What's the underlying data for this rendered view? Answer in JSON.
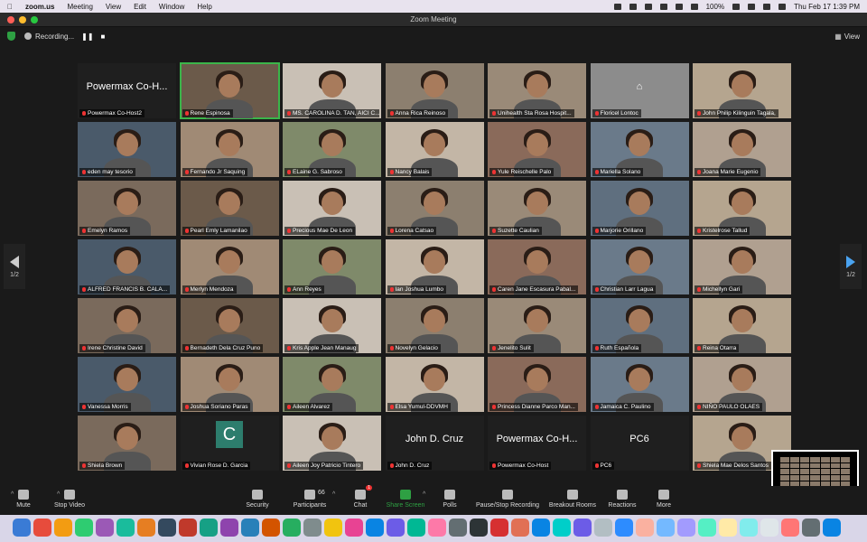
{
  "menubar": {
    "app": "zoom.us",
    "items": [
      "Meeting",
      "View",
      "Edit",
      "Window",
      "Help"
    ],
    "battery": "100%",
    "datetime": "Thu Feb 17  1:39 PM"
  },
  "window": {
    "title": "Zoom Meeting"
  },
  "topbar": {
    "recording_label": "Recording...",
    "view_label": "View"
  },
  "pager": {
    "left": "1/2",
    "right": "1/2"
  },
  "participants": [
    {
      "name": "Powermax Co-Host2",
      "display": "Powermax Co-H..."
    },
    {
      "name": "Rene Espinosa"
    },
    {
      "name": "MS. CAROLINA D. TAN, AICI C..."
    },
    {
      "name": "Anna Rica Reinoso"
    },
    {
      "name": "Unihealth Sta Rosa Hospit..."
    },
    {
      "name": "Floricel Lontoc"
    },
    {
      "name": "John Philip Kilinguin Tagala,"
    },
    {
      "name": "eden may tesorio"
    },
    {
      "name": "Fernando Jr Saquing"
    },
    {
      "name": "ELaine G. Sabroso"
    },
    {
      "name": "Nancy Balais"
    },
    {
      "name": "Yule Reischelle Palo"
    },
    {
      "name": "Mariella Solano"
    },
    {
      "name": "Joana Marie Eugenio"
    },
    {
      "name": "Emelyn Ramos"
    },
    {
      "name": "Pearl Emly Lamanilao"
    },
    {
      "name": "Precious Mae De Leon"
    },
    {
      "name": "Lorena Catsao"
    },
    {
      "name": "Suzette Caulian"
    },
    {
      "name": "Marjorie Orillano"
    },
    {
      "name": "Kristelrose Tallud"
    },
    {
      "name": "ALFRED FRANCIS B. CALA..."
    },
    {
      "name": "Merlyn Mendoza"
    },
    {
      "name": "Ann Reyes"
    },
    {
      "name": "Ian Joshua Lumbo"
    },
    {
      "name": "Caren Jane Escasura Pabal..."
    },
    {
      "name": "Christian Larr Lagua"
    },
    {
      "name": "Michellyn Gari"
    },
    {
      "name": "Irene Christine David"
    },
    {
      "name": "Bernadeth Dela Cruz Puno"
    },
    {
      "name": "Kris Apple Jean Manaug"
    },
    {
      "name": "Novelyn Gelacio"
    },
    {
      "name": "Jenelito Sulit"
    },
    {
      "name": "Ruth Española"
    },
    {
      "name": "Reina Otarra"
    },
    {
      "name": "Vanessa Morris"
    },
    {
      "name": "Joshua Soriano Paras"
    },
    {
      "name": "Aileen Alvarez"
    },
    {
      "name": "Elsa Yumul-DDVMH"
    },
    {
      "name": "Princess Dianne Parco Man..."
    },
    {
      "name": "Jamaica C. Paulino"
    },
    {
      "name": "NIÑO PAULO OLAES"
    },
    {
      "name": "Shiela Brown"
    },
    {
      "name": "Vivian Rose D. Garcia",
      "display": "C"
    },
    {
      "name": "Aileen Joy Patricio Tintero"
    },
    {
      "name": "John D. Cruz",
      "display": "John D. Cruz"
    },
    {
      "name": "Powermax Co-Host",
      "display": "Powermax Co-H..."
    },
    {
      "name": "PC6",
      "display": "PC6"
    },
    {
      "name": "Shiela Mae Delos Santos"
    }
  ],
  "toolbar": {
    "mute": "Mute",
    "stop_video": "Stop Video",
    "security": "Security",
    "participants": "Participants",
    "participant_count": "66",
    "chat": "Chat",
    "chat_badge": "1",
    "share_screen": "Share Screen",
    "polls": "Polls",
    "recording": "Pause/Stop Recording",
    "breakout": "Breakout Rooms",
    "reactions": "Reactions",
    "more": "More"
  },
  "colors": {
    "accent": "#2ea043",
    "muted_mic": "#e33333",
    "active_border": "#3bb54a"
  }
}
